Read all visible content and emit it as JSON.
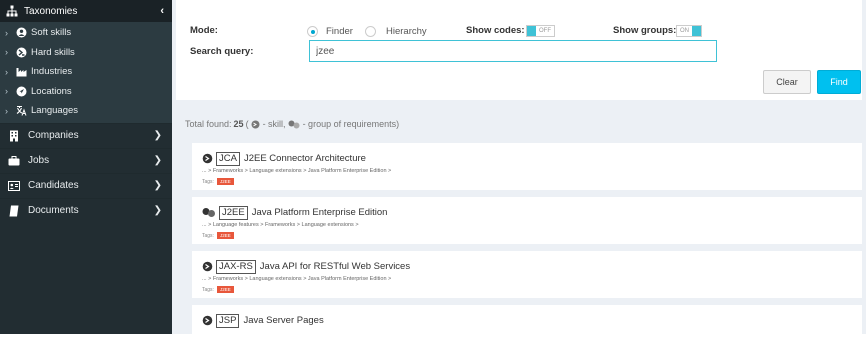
{
  "sidebar": {
    "taxonomies": {
      "title": "Taxonomies",
      "items": [
        {
          "label": "Soft skills"
        },
        {
          "label": "Hard skills"
        },
        {
          "label": "Industries"
        },
        {
          "label": "Locations"
        },
        {
          "label": "Languages"
        }
      ]
    },
    "menu": [
      {
        "label": "Companies"
      },
      {
        "label": "Jobs"
      },
      {
        "label": "Candidates"
      },
      {
        "label": "Documents"
      }
    ]
  },
  "form": {
    "mode_label": "Mode:",
    "mode_options": [
      "Finder",
      "Hierarchy"
    ],
    "mode_selected": "Finder",
    "show_codes_label": "Show codes:",
    "show_codes_state": "OFF",
    "show_groups_label": "Show groups:",
    "show_groups_state": "ON",
    "search_label": "Search query:",
    "search_value": "jzee",
    "clear_label": "Clear",
    "find_label": "Find"
  },
  "summary": {
    "prefix": "Total found:",
    "count": "25",
    "open": "(",
    "skill_text": "- skill,",
    "group_text": "- group of requirements)"
  },
  "results": [
    {
      "code": "JCA",
      "title": "J2EE Connector Architecture",
      "path": "... > Frameworks > Language extensions > Java Platform Enterprise Edition >",
      "tags_label": "Tags:",
      "tag": "J2EE",
      "icon": "skill"
    },
    {
      "code": "J2EE",
      "title": "Java Platform Enterprise Edition",
      "path": "... > Language features > Frameworks > Language extensions >",
      "tags_label": "Tags:",
      "tag": "J2EE",
      "icon": "group"
    },
    {
      "code": "JAX-RS",
      "title": "Java API for RESTful Web Services",
      "path": "... > Frameworks > Language extensions > Java Platform Enterprise Edition >",
      "tags_label": "Tags:",
      "tag": "J2EE",
      "icon": "skill"
    },
    {
      "code": "JSP",
      "title": "Java Server Pages",
      "path": "",
      "tags_label": "",
      "tag": "",
      "icon": "skill"
    }
  ]
}
